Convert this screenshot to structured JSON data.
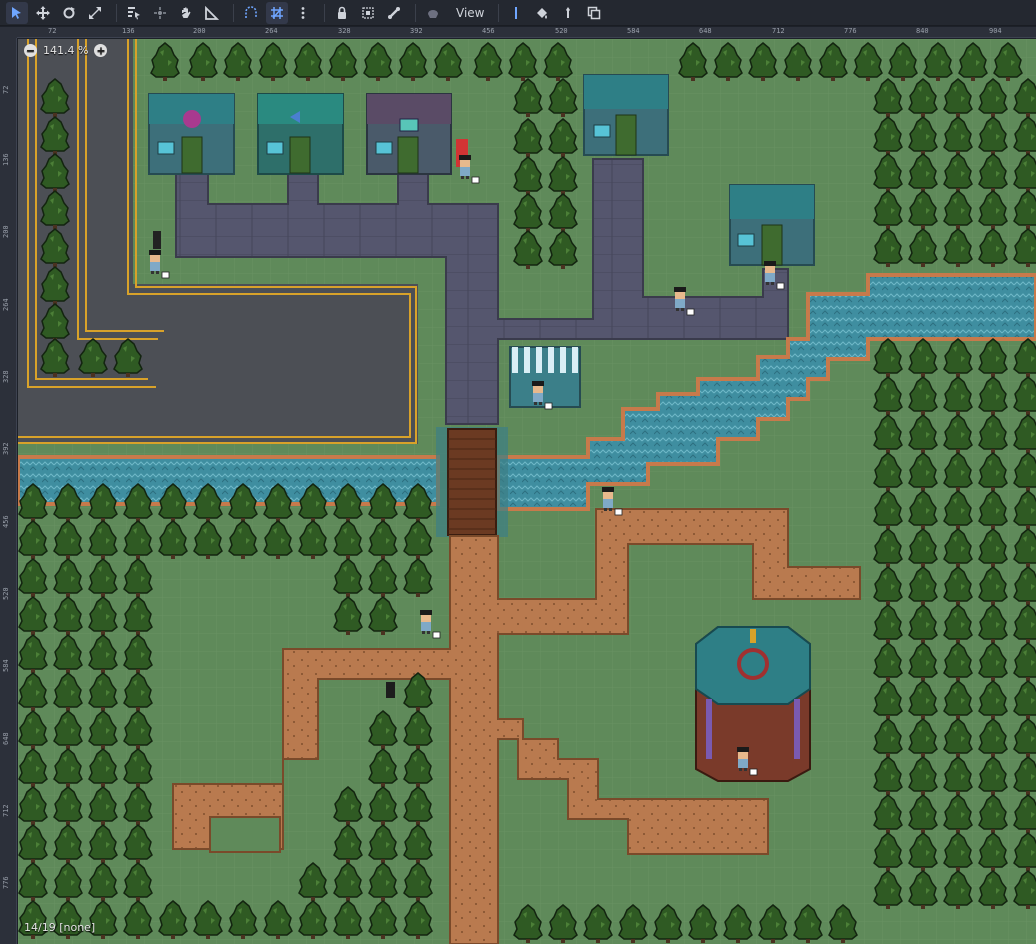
{
  "toolbar": {
    "view_label": "View"
  },
  "viewport": {
    "zoom_label": "141.4 %",
    "status_text": "14/19 [none]"
  },
  "ruler": {
    "top_labels": [
      "72",
      "136",
      "200",
      "264",
      "328",
      "392",
      "456",
      "520",
      "584",
      "648",
      "712",
      "776",
      "840",
      "904"
    ],
    "left_labels": [
      "72",
      "136",
      "200",
      "264",
      "328",
      "392",
      "456",
      "520",
      "584",
      "648",
      "712",
      "776"
    ]
  },
  "colors": {
    "grass": "#5f8a5a",
    "tree": "#2f5a23",
    "road": "#4c4f55",
    "road_line": "#d8a22a",
    "sidewalk": "#55566e",
    "water": "#3f8ea0",
    "dirt": "#b97a4f",
    "roof": "#2e7f86",
    "building_wall": "#3d6f7a"
  }
}
